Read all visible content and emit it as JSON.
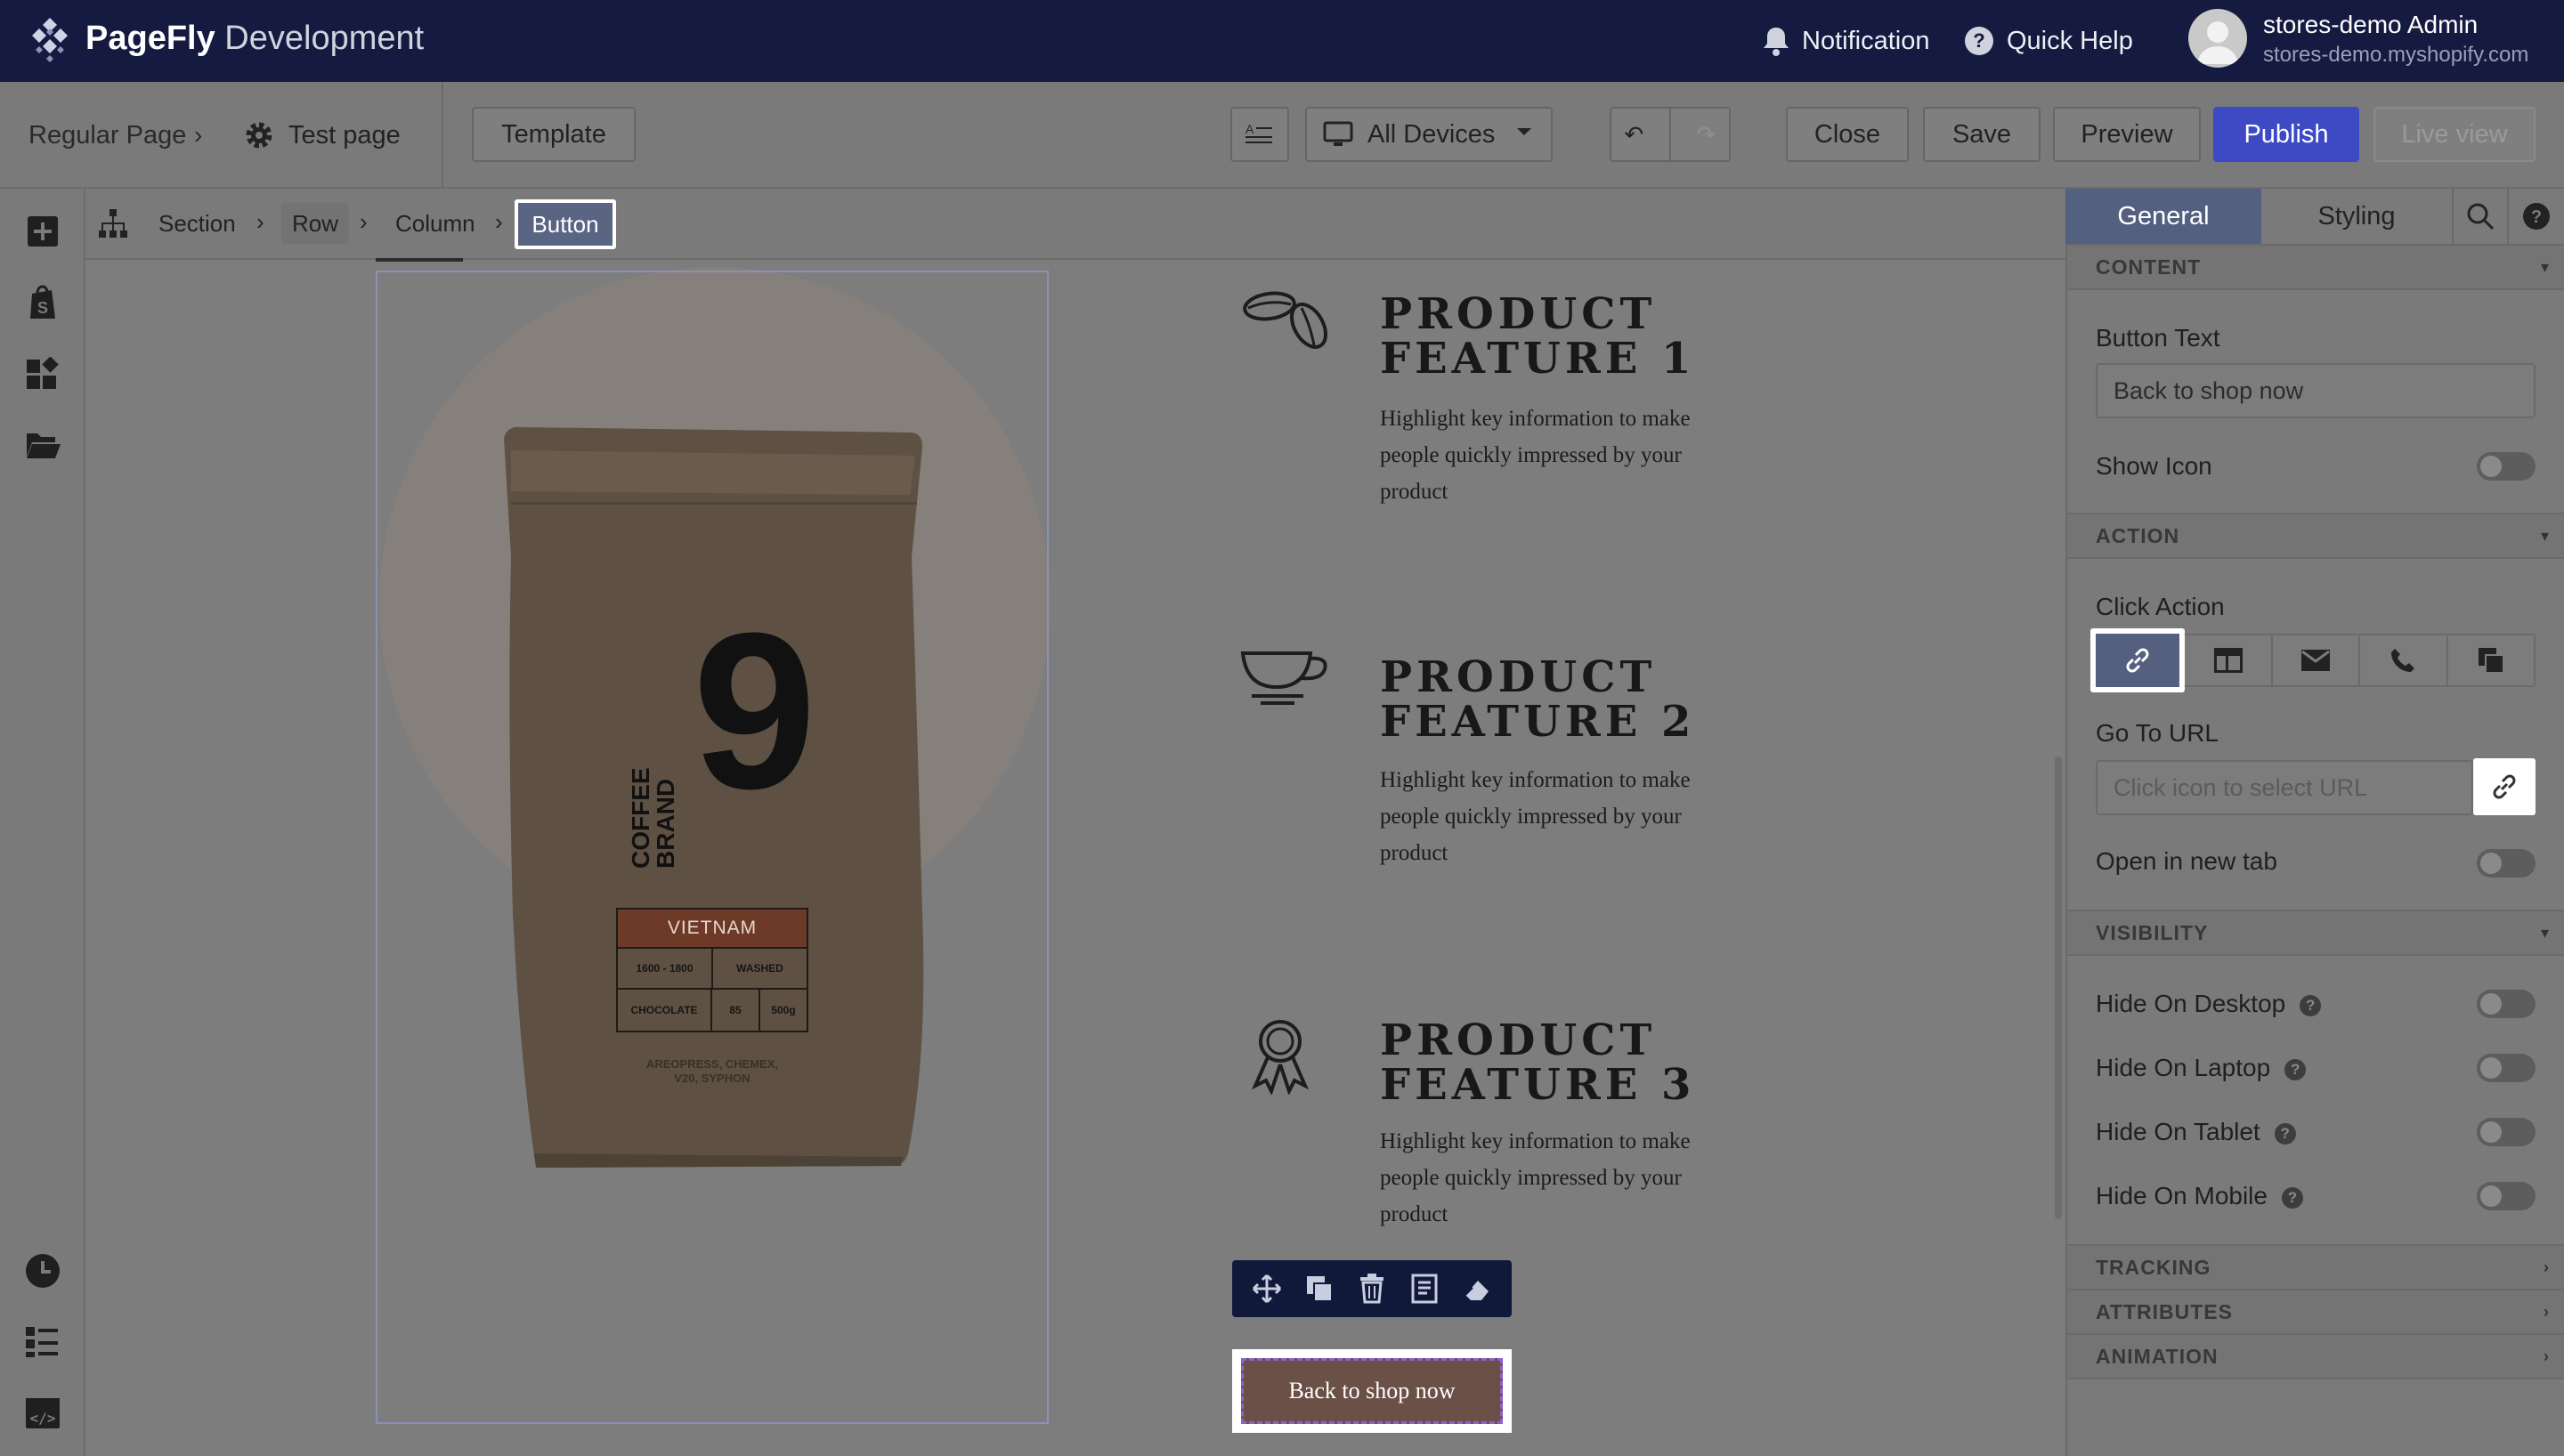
{
  "app": {
    "brand_name": "PageFly",
    "brand_suffix": "Development",
    "notification_label": "Notification",
    "help_label": "Quick Help",
    "user_name": "stores-demo Admin",
    "user_store": "stores-demo.myshopify.com"
  },
  "toolbar": {
    "page_type": "Regular Page",
    "page_name": "Test page",
    "template_label": "Template",
    "devices_label": "All Devices",
    "close_label": "Close",
    "save_label": "Save",
    "preview_label": "Preview",
    "publish_label": "Publish",
    "live_view_label": "Live view"
  },
  "element_breadcrumb": {
    "items": [
      "Section",
      "Row",
      "Column",
      "Button"
    ]
  },
  "canvas": {
    "product": {
      "brand_line1": "COFFEE",
      "brand_line2": "BRAND",
      "number": "9",
      "origin": "VIETNAM",
      "altitude": "1600 - 1800",
      "process": "WASHED",
      "note": "CHOCOLATE",
      "score": "85",
      "weight": "500g",
      "methods_line1": "AREOPRESS, CHEMEX,",
      "methods_line2": "V20, SYPHON"
    },
    "features": [
      {
        "title_line1": "PRODUCT",
        "title_line2": "FEATURE 1",
        "icon": "coffee-beans-icon",
        "desc": "Highlight key information to make people quickly impressed by your product"
      },
      {
        "title_line1": "PRODUCT",
        "title_line2": "FEATURE 2",
        "icon": "coffee-cup-icon",
        "desc": "Highlight key information to make people quickly impressed by your product"
      },
      {
        "title_line1": "PRODUCT",
        "title_line2": "FEATURE 3",
        "icon": "award-ribbon-icon",
        "desc": "Highlight key information to make people quickly impressed by your product"
      }
    ],
    "button_text": "Back to shop now"
  },
  "panel": {
    "tabs": [
      "General",
      "Styling"
    ],
    "sections": {
      "content": "CONTENT",
      "action": "ACTION",
      "visibility": "VISIBILITY",
      "tracking": "TRACKING",
      "attributes": "ATTRIBUTES",
      "animation": "ANIMATION"
    },
    "button_text_label": "Button Text",
    "button_text_value": "Back to shop now",
    "show_icon_label": "Show Icon",
    "click_action_label": "Click Action",
    "go_to_url_label": "Go To URL",
    "url_placeholder": "Click icon to select URL",
    "open_new_tab_label": "Open in new tab",
    "hide_desktop": "Hide On Desktop",
    "hide_laptop": "Hide On Laptop",
    "hide_tablet": "Hide On Tablet",
    "hide_mobile": "Hide On Mobile",
    "help_glyph": "?"
  },
  "colors": {
    "topbar": "#141a40",
    "primary": "#3e4ac4",
    "active_tab": "#53607f",
    "button_bg": "#6b5047"
  }
}
